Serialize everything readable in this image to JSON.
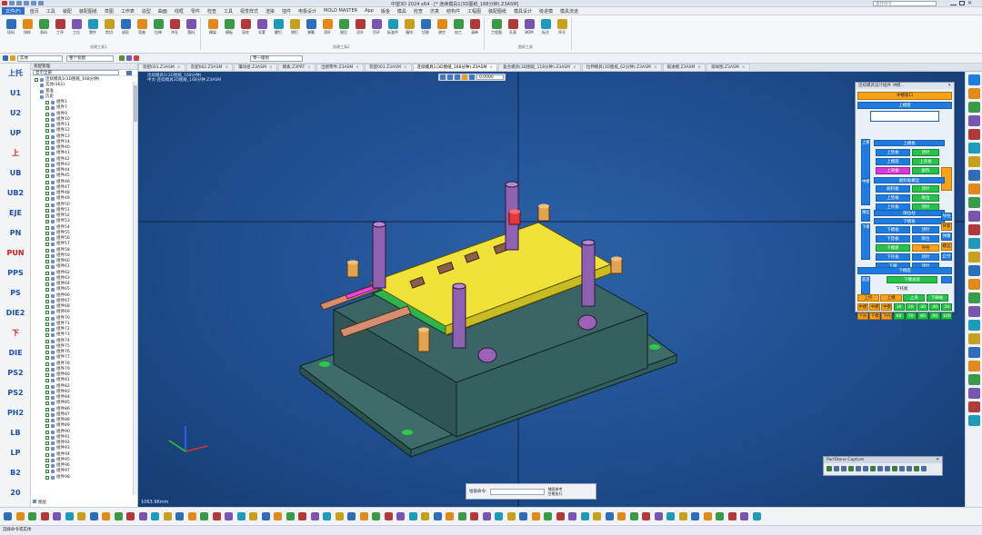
{
  "window": {
    "title": "中望3D 2024 x64 - [* 连续模具1(3D图纸_168分钟).Z3ASM]",
    "search_placeholder": "查找命令"
  },
  "menu": [
    "文件(F)",
    "首页",
    "工具",
    "装配",
    "装配图纸",
    "草图",
    "工作表",
    "造型",
    "曲面",
    "线框",
    "零件",
    "检查",
    "工具",
    "视觉样式",
    "渲染",
    "插件",
    "电极设计",
    "MOLD MASTER",
    "App",
    "钣金",
    "模具",
    "检查",
    "仿真",
    "结构件",
    "工程图",
    "装配图纸",
    "模具设计",
    "级进模",
    "模具流道"
  ],
  "ribbon": {
    "groups": [
      {
        "label": "创建工具1",
        "buttons": [
          "坯料",
          "排样",
          "条料",
          "工序",
          "工位",
          "零件",
          "剪切",
          "成形",
          "弯曲",
          "拉伸",
          "冲孔",
          "落料"
        ]
      },
      {
        "label": "创建工具2",
        "buttons": [
          "模架",
          "模板",
          "导柱",
          "导套",
          "螺钉",
          "销钉",
          "弹簧",
          "顶杆",
          "限位",
          "浮升",
          "吊环",
          "标准件",
          "镶块",
          "切割",
          "避空",
          "加工",
          "清单"
        ]
      },
      {
        "label": "图纸工具",
        "buttons": [
          "工程图",
          "孔表",
          "BOM",
          "标注",
          "序号"
        ]
      }
    ]
  },
  "filterbar": {
    "filter_value": "实体",
    "select_value": "整个装配",
    "layer_value": "零一级别"
  },
  "doc_tabs": [
    {
      "label": "装配001.Z3ASM",
      "active": false
    },
    {
      "label": "装配002.Z3ASM",
      "active": false
    },
    {
      "label": "镶块组.Z3ASM",
      "active": false
    },
    {
      "label": "模板.Z3PRT",
      "active": false
    },
    {
      "label": "出图零件.Z3ASM",
      "active": false
    },
    {
      "label": "装配003.Z3ASM",
      "active": false
    },
    {
      "label": "连续模具1(3D图纸_168分钟).Z3ASM",
      "active": true
    },
    {
      "label": "复合模具(3D图纸_118分钟).Z3ASM",
      "active": false
    },
    {
      "label": "拉伸模具(3D图纸_62分钟).Z3ASM",
      "active": false
    },
    {
      "label": "级进模.Z3ASM",
      "active": false
    },
    {
      "label": "排样图.Z3ASM",
      "active": false
    }
  ],
  "left_strip": [
    {
      "label": "上托",
      "color": "#1b4fb0"
    },
    {
      "label": "U1",
      "color": "#1b4fb0"
    },
    {
      "label": "U2",
      "color": "#1b4fb0"
    },
    {
      "label": "UP",
      "color": "#1b4fb0"
    },
    {
      "label": "上",
      "color": "#d01818"
    },
    {
      "label": "UB",
      "color": "#1b4fb0"
    },
    {
      "label": "UB2",
      "color": "#1b4fb0"
    },
    {
      "label": "EJE",
      "color": "#1b4fb0"
    },
    {
      "label": "PN",
      "color": "#1b4fb0"
    },
    {
      "label": "PUN",
      "color": "#d01818"
    },
    {
      "label": "PPS",
      "color": "#1b4fb0"
    },
    {
      "label": "PS",
      "color": "#1b4fb0"
    },
    {
      "label": "DIE2",
      "color": "#1b4fb0"
    },
    {
      "label": "下",
      "color": "#d01818"
    },
    {
      "label": "DIE",
      "color": "#1b4fb0"
    },
    {
      "label": "PS2",
      "color": "#1b4fb0"
    },
    {
      "label": "PS2",
      "color": "#1b4fb0"
    },
    {
      "label": "PH2",
      "color": "#1b4fb0"
    },
    {
      "label": "LB",
      "color": "#1b4fb0"
    },
    {
      "label": "LP",
      "color": "#1b4fb0"
    },
    {
      "label": "B2",
      "color": "#1b4fb0"
    },
    {
      "label": "20",
      "color": "#1b4fb0"
    }
  ],
  "tree": {
    "header": "装配管理",
    "filter_label": "显示全部",
    "root": "连续模具1(3D图纸_168分钟)",
    "nodes": [
      "实体(361)",
      "基准",
      "历史"
    ],
    "items": [
      "组件1",
      "组件7",
      "组件9",
      "组件10",
      "组件11",
      "组件12",
      "组件13",
      "组件14",
      "组件40",
      "组件41",
      "组件42",
      "组件43",
      "组件44",
      "组件45",
      "组件46",
      "组件47",
      "组件48",
      "组件49",
      "组件50",
      "组件51",
      "组件52",
      "组件53",
      "组件54",
      "组件55",
      "组件56",
      "组件57",
      "组件58",
      "组件59",
      "组件60",
      "组件61",
      "组件62",
      "组件63",
      "组件64",
      "组件65",
      "组件66",
      "组件67",
      "组件68",
      "组件69",
      "组件70",
      "组件71",
      "组件72",
      "组件73",
      "组件74",
      "组件75",
      "组件76",
      "组件77",
      "组件78",
      "组件79",
      "组件80",
      "组件81",
      "组件82",
      "组件83",
      "组件84",
      "组件85",
      "组件86",
      "组件87",
      "组件88",
      "组件89",
      "组件90",
      "组件91",
      "组件92",
      "组件93",
      "组件94",
      "组件95",
      "组件96",
      "组件97",
      "组件98"
    ],
    "footer": "图层"
  },
  "viewport": {
    "info_lines": [
      "连续模具1(3D图纸_168分钟)",
      "中文-连续模具3D图纸_168分钟.Z3ASM"
    ],
    "toolbar_value": "0.0000",
    "coord_readout": "1063.96mm",
    "cmd_label": "拾取命令:",
    "cmd_opt1": "捕捉参考",
    "cmd_opt2": "空格执行"
  },
  "mold_dialog": {
    "title": "连续模具设计插件 冲模...",
    "header": "冲模窗口",
    "section_top": "上模座",
    "group_upper": "上模",
    "row_upper": "上模板",
    "buttons_upper": [
      [
        "上垫板",
        "顶针"
      ],
      [
        "上模座",
        "上夹板"
      ],
      [
        "上夹板",
        "脱料"
      ]
    ],
    "group_mid": "中模",
    "row_mid": "脱料板螺丝",
    "buttons_mid": [
      [
        "脱料板",
        "顶针"
      ],
      [
        "上垫板",
        "限位"
      ],
      [
        "上托板",
        "顶针"
      ]
    ],
    "group_stop": "限位",
    "row_stop": "限位柱",
    "group_lower": "下模",
    "row_lower": "下模板",
    "buttons_lower": [
      [
        "下模板",
        "顶针"
      ],
      [
        "下垫板",
        "限位"
      ],
      [
        "下模座",
        "导柱"
      ],
      [
        "下托板",
        "顶针"
      ],
      [
        "下脚",
        "顶针"
      ]
    ],
    "section_bottom": "下模座",
    "bottom_btn": "下模总装",
    "group_base": "底座",
    "sub_label": "下托板",
    "right_labels": [
      "导柱",
      "导套",
      "弹簧",
      "螺丝",
      "止付"
    ],
    "grid": [
      [
        "上托",
        "上模",
        "上夹",
        "下脚板"
      ],
      [
        "中模",
        "中模",
        "中模",
        "10",
        "20",
        "30",
        "40",
        "50"
      ],
      [
        "下托",
        "下模",
        "下托",
        "60",
        "70",
        "80",
        "90",
        "100"
      ]
    ]
  },
  "capture": {
    "title": "PartStone Capture"
  },
  "statusbar": {
    "text": "选择命令或实体"
  },
  "colors": {
    "viewport_bg": "#1f4e8f",
    "plate_teal": "#3e6c6b",
    "plate_yellow": "#f1e23a",
    "accent_blue": "#1e7be0",
    "accent_green": "#27c24a"
  }
}
